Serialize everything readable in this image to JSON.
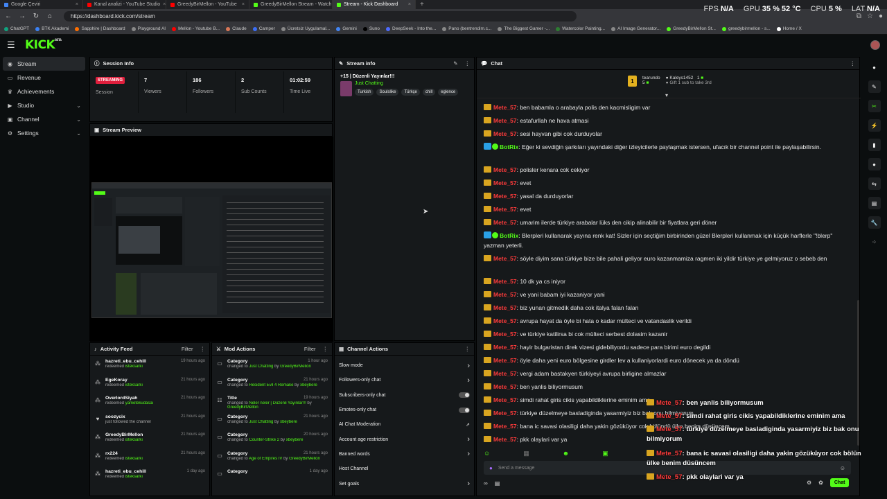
{
  "browser": {
    "tabs": [
      {
        "title": "Google Çeviri",
        "color": "#4285f4",
        "active": false
      },
      {
        "title": "Kanal analizi - YouTube Studio",
        "color": "#ff0000",
        "active": false
      },
      {
        "title": "GreedyBirMellon - YouTube",
        "color": "#ff0000",
        "active": false
      },
      {
        "title": "GreedyBirMellon Stream - Watch",
        "color": "#53fc18",
        "active": false
      },
      {
        "title": "Stream - Kick Dashboard",
        "color": "#53fc18",
        "active": true
      }
    ],
    "new_tab": "+",
    "url": "https://dashboard.kick.com/stream",
    "bookmarks": [
      "ChatGPT",
      "BTK Akademi",
      "Sapphire | Dashboard",
      "Playground AI",
      "Mellon - Youtube B...",
      "Claude",
      "Camper",
      "Ücretsiz Uygulamal...",
      "Gemini",
      "Suno",
      "DeepSeek - Into the...",
      "Pano (bentrendim.c...",
      "The Biggest Gamer -...",
      "Watercolor Painting...",
      "AI Image Generator...",
      "GreedyBirMellon St...",
      "greedybirmellon - s...",
      "Home / X"
    ]
  },
  "perf": {
    "fps_label": "FPS",
    "fps": "N/A",
    "gpu_label": "GPU",
    "gpu": "35 % 52 °C",
    "cpu_label": "CPU",
    "cpu": "5 %",
    "lat_label": "LAT",
    "lat": "N/A"
  },
  "header": {
    "logo": "KICK",
    "beta": "BETA"
  },
  "sidebar": {
    "items": [
      {
        "label": "Stream",
        "icon": "broadcast-icon",
        "active": true,
        "chevron": false
      },
      {
        "label": "Revenue",
        "icon": "wallet-icon",
        "active": false,
        "chevron": false
      },
      {
        "label": "Achievements",
        "icon": "trophy-icon",
        "active": false,
        "chevron": false
      },
      {
        "label": "Studio",
        "icon": "video-icon",
        "active": false,
        "chevron": true
      },
      {
        "label": "Channel",
        "icon": "channel-icon",
        "active": false,
        "chevron": true
      },
      {
        "label": "Settings",
        "icon": "gear-icon",
        "active": false,
        "chevron": true
      }
    ]
  },
  "session": {
    "title": "Session Info",
    "status": "STREAMING",
    "status_label": "Session",
    "stats": [
      {
        "value": "7",
        "label": "Viewers"
      },
      {
        "value": "186",
        "label": "Followers"
      },
      {
        "value": "2",
        "label": "Sub Counts"
      },
      {
        "value": "01:02:59",
        "label": "Time Live"
      }
    ]
  },
  "preview": {
    "title": "Stream Preview"
  },
  "stream_info": {
    "title": "Stream info",
    "stream_title": "+15 | Düzenli Yayınlar!!!",
    "category": "Just Chatting",
    "tags": [
      "Turkish",
      "Soulslike",
      "Türkçe",
      "chill",
      "eglence"
    ]
  },
  "chat": {
    "title": "Chat",
    "leaderboard": {
      "first_name": "tearundo",
      "first_count": "5",
      "second_name": "Kaleys1452",
      "second_count": "1",
      "gift_text": "Gift 1 sub to take 3rd"
    },
    "messages": [
      {
        "user": "Mete_57",
        "text": "ben babamla o arabayla polis den kacmisligim var",
        "bot": false
      },
      {
        "user": "Mete_57",
        "text": "estafurllah ne hava atmasi",
        "bot": false
      },
      {
        "user": "Mete_57",
        "text": "sesi hayvan gibi cok durduyolar",
        "bot": false
      },
      {
        "user": "BotRix",
        "text": "Eğer ki sevdiğin şarkıları yayındaki diğer izleyicilerle paylaşmak istersen, ufacık bir channel point ile paylaşabilirsin.",
        "bot": true
      },
      {
        "user": "Mete_57",
        "text": "polisler kenara cok cekiyor",
        "bot": false
      },
      {
        "user": "Mete_57",
        "text": "evet",
        "bot": false
      },
      {
        "user": "Mete_57",
        "text": "yasal da durduyorlar",
        "bot": false
      },
      {
        "user": "Mete_57",
        "text": "evet",
        "bot": false
      },
      {
        "user": "Mete_57",
        "text": "umarim ilerde türkiye arabalar lüks den cikip alinabilir bir fiyatlara geri döner",
        "bot": false
      },
      {
        "user": "BotRix",
        "text": "Blerpleri kullanarak yayına renk kat! Sizler için seçtiğim birbirinden güzel Blerpleri kullanmak için küçük harflerle \"!blerp\" yazman yeterli.",
        "bot": true
      },
      {
        "user": "Mete_57",
        "text": "söyle diyim sana türkiye bize bile pahali geliyor euro kazanmamiza ragmen iki yildir türkiye ye gelmiyoruz o sebeb den",
        "bot": false
      },
      {
        "user": "Mete_57",
        "text": "10 dk ya cs iniyor",
        "bot": false
      },
      {
        "user": "Mete_57",
        "text": "ve yani babam iyi kazaniyor yani",
        "bot": false
      },
      {
        "user": "Mete_57",
        "text": "biz yunan gitmedik daha cok italya falan falan",
        "bot": false
      },
      {
        "user": "Mete_57",
        "text": "avrupa hayat da öyle bi hata o kadar mülteci ve vatandaslik verildi",
        "bot": false
      },
      {
        "user": "Mete_57",
        "text": "ve türkiye katilirsa bi cok mülteci serbest dolasim kazanir",
        "bot": false
      },
      {
        "user": "Mete_57",
        "text": "hayir bulgaristan direk vizesi gidebiliyordu sadece para birimi euro degildi",
        "bot": false
      },
      {
        "user": "Mete_57",
        "text": "öyle daha yeni euro bölgesine girdler lev a kullaniyorlardi euro dönecek ya da döndü",
        "bot": false
      },
      {
        "user": "Mete_57",
        "text": "vergi adam bastakyen türkiyeyi avrupa birligine almazlar",
        "bot": false
      },
      {
        "user": "Mete_57",
        "text": "ben yanlis biliyormusum",
        "bot": false
      },
      {
        "user": "Mete_57",
        "text": "simdi rahat giris cikis yapabildiklerine eminim ama",
        "bot": false
      },
      {
        "user": "Mete_57",
        "text": "türkiye düzelmeye basladiginda yasarmiyiz biz bak onu bilmiyorum",
        "bot": false
      },
      {
        "user": "Mete_57",
        "text": "bana ic savasi olasiligi daha yakin gözüküyor cok bölündü ülke benim düsüncem",
        "bot": false
      },
      {
        "user": "Mete_57",
        "text": "pkk olaylari var ya",
        "bot": false
      }
    ],
    "input_placeholder": "Send a message",
    "send_label": "Chat",
    "separator": ":"
  },
  "overlay": {
    "messages": [
      {
        "user": "Mete_57",
        "text": "ben yanlis biliyormusum"
      },
      {
        "user": "Mete_57",
        "text": "simdi rahat giris cikis yapabildiklerine eminim ama"
      },
      {
        "user": "Mete_57",
        "text": "türkiye düzelmeye basladiginda yasarmiyiz biz bak onu bilmiyorum"
      },
      {
        "user": "Mete_57",
        "text": "bana ic savasi olasiligi daha yakin gözüküyor cok bölündü ülke benim düsüncem"
      },
      {
        "user": "Mete_57",
        "text": "pkk olaylari var ya"
      }
    ]
  },
  "activity": {
    "title": "Activity Feed",
    "filter": "Filter",
    "items": [
      {
        "user": "hazreti_ebu_cehill",
        "time": "19 hours ago",
        "action": "redeemed",
        "detail": "isteksarkı"
      },
      {
        "user": "EgeKoray",
        "time": "21 hours ago",
        "action": "redeemed",
        "detail": "isteksarkı"
      },
      {
        "user": "OverlordSiyah",
        "time": "21 hours ago",
        "action": "redeemed",
        "detail": "yametekudasai"
      },
      {
        "user": "soozycix",
        "time": "21 hours ago",
        "action": "just followed the channel",
        "detail": ""
      },
      {
        "user": "GreedyBirMellon",
        "time": "21 hours ago",
        "action": "redeemed",
        "detail": "isteksarkı"
      },
      {
        "user": "rx224",
        "time": "21 hours ago",
        "action": "redeemed",
        "detail": "isteksarkı"
      },
      {
        "user": "hazreti_ebu_cehill",
        "time": "1 day ago",
        "action": "redeemed",
        "detail": "isteksarkı"
      }
    ]
  },
  "mod_actions": {
    "title": "Mod Actions",
    "filter": "Filter",
    "items": [
      {
        "kind": "Category",
        "time": "1 hour ago",
        "prefix": "changed to",
        "value": "Just Chatting",
        "by": "by",
        "mod": "GreedyBirMellon"
      },
      {
        "kind": "Category",
        "time": "21 hours ago",
        "prefix": "changed to",
        "value": "Resident Evil 4 Remake",
        "by": "by",
        "mod": "xbeybere"
      },
      {
        "kind": "Title",
        "time": "19 hours ago",
        "prefix": "changed to",
        "value": "Neler neler | Düzenli Yayınlar!!!",
        "by": "by",
        "mod": "GreedyBirMellon"
      },
      {
        "kind": "Category",
        "time": "21 hours ago",
        "prefix": "changed to",
        "value": "Just Chatting",
        "by": "by",
        "mod": "xbeybere"
      },
      {
        "kind": "Category",
        "time": "20 hours ago",
        "prefix": "changed to",
        "value": "Counter-Strike 2",
        "by": "by",
        "mod": "xbeybere"
      },
      {
        "kind": "Category",
        "time": "21 hours ago",
        "prefix": "changed to",
        "value": "Age of Empires IV",
        "by": "by",
        "mod": "GreedyBirMellon"
      },
      {
        "kind": "Category",
        "time": "1 day ago",
        "prefix": "",
        "value": "",
        "by": "",
        "mod": ""
      }
    ]
  },
  "channel_actions": {
    "title": "Channel Actions",
    "items": [
      {
        "label": "Slow mode",
        "control": "chevron"
      },
      {
        "label": "Followers-only chat",
        "control": "chevron"
      },
      {
        "label": "Subscribers-only chat",
        "control": "toggle"
      },
      {
        "label": "Emotes-only chat",
        "control": "toggle"
      },
      {
        "label": "AI Chat Moderation",
        "control": "chart"
      },
      {
        "label": "Account age restriction",
        "control": "chevron"
      },
      {
        "label": "Banned words",
        "control": "chevron"
      },
      {
        "label": "Host Channel",
        "control": "none"
      },
      {
        "label": "Set goals",
        "control": "chevron"
      }
    ]
  },
  "colors": {
    "brand": "#53fc18",
    "live": "#e01f3d",
    "mod_user": "#ff3b3b"
  }
}
